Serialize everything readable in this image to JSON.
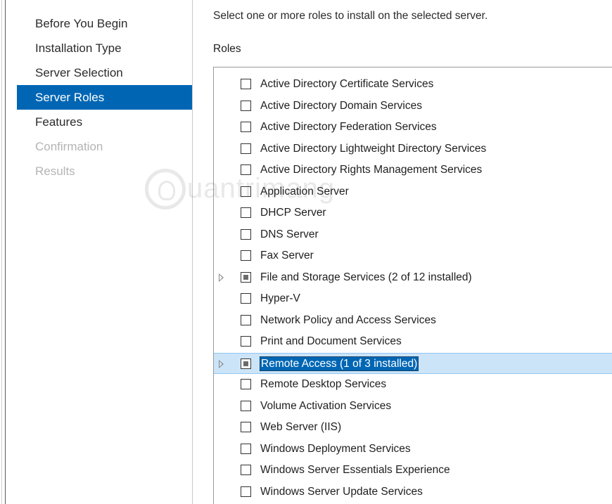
{
  "nav": {
    "items": [
      {
        "label": "Before You Begin",
        "state": "normal"
      },
      {
        "label": "Installation Type",
        "state": "normal"
      },
      {
        "label": "Server Selection",
        "state": "normal"
      },
      {
        "label": "Server Roles",
        "state": "selected"
      },
      {
        "label": "Features",
        "state": "normal"
      },
      {
        "label": "Confirmation",
        "state": "disabled"
      },
      {
        "label": "Results",
        "state": "disabled"
      }
    ]
  },
  "main": {
    "instruction": "Select one or more roles to install on the selected server.",
    "roles_label": "Roles",
    "roles": [
      {
        "label": "Active Directory Certificate Services",
        "check": "unchecked",
        "expandable": false,
        "selected": false
      },
      {
        "label": "Active Directory Domain Services",
        "check": "unchecked",
        "expandable": false,
        "selected": false
      },
      {
        "label": "Active Directory Federation Services",
        "check": "unchecked",
        "expandable": false,
        "selected": false
      },
      {
        "label": "Active Directory Lightweight Directory Services",
        "check": "unchecked",
        "expandable": false,
        "selected": false
      },
      {
        "label": "Active Directory Rights Management Services",
        "check": "unchecked",
        "expandable": false,
        "selected": false
      },
      {
        "label": "Application Server",
        "check": "unchecked",
        "expandable": false,
        "selected": false
      },
      {
        "label": "DHCP Server",
        "check": "unchecked",
        "expandable": false,
        "selected": false
      },
      {
        "label": "DNS Server",
        "check": "unchecked",
        "expandable": false,
        "selected": false
      },
      {
        "label": "Fax Server",
        "check": "unchecked",
        "expandable": false,
        "selected": false
      },
      {
        "label": "File and Storage Services (2 of 12 installed)",
        "check": "partial",
        "expandable": true,
        "selected": false
      },
      {
        "label": "Hyper-V",
        "check": "unchecked",
        "expandable": false,
        "selected": false
      },
      {
        "label": "Network Policy and Access Services",
        "check": "unchecked",
        "expandable": false,
        "selected": false
      },
      {
        "label": "Print and Document Services",
        "check": "unchecked",
        "expandable": false,
        "selected": false
      },
      {
        "label": "Remote Access (1 of 3 installed)",
        "check": "partial",
        "expandable": true,
        "selected": true
      },
      {
        "label": "Remote Desktop Services",
        "check": "unchecked",
        "expandable": false,
        "selected": false
      },
      {
        "label": "Volume Activation Services",
        "check": "unchecked",
        "expandable": false,
        "selected": false
      },
      {
        "label": "Web Server (IIS)",
        "check": "unchecked",
        "expandable": false,
        "selected": false
      },
      {
        "label": "Windows Deployment Services",
        "check": "unchecked",
        "expandable": false,
        "selected": false
      },
      {
        "label": "Windows Server Essentials Experience",
        "check": "unchecked",
        "expandable": false,
        "selected": false
      },
      {
        "label": "Windows Server Update Services",
        "check": "unchecked",
        "expandable": false,
        "selected": false
      }
    ]
  },
  "watermark": {
    "text": "uantrimang",
    "icon": "lightbulb-icon"
  },
  "colors": {
    "accent": "#0066b4",
    "selection_bg": "#cce4f7",
    "disabled_text": "#b4b4b4"
  }
}
